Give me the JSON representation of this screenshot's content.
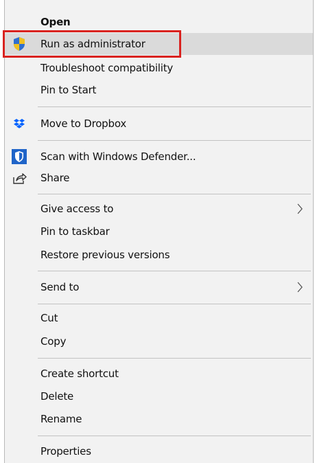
{
  "menu": {
    "items": [
      {
        "id": "open",
        "label": "Open",
        "icon": ""
      },
      {
        "id": "run_admin",
        "label": "Run as administrator",
        "icon": "shield-icon"
      },
      {
        "id": "troubleshoot",
        "label": "Troubleshoot compatibility",
        "icon": ""
      },
      {
        "id": "pin_start",
        "label": "Pin to Start",
        "icon": ""
      },
      {
        "id": "dropbox",
        "label": "Move to Dropbox",
        "icon": "dropbox-icon"
      },
      {
        "id": "defender",
        "label": "Scan with Windows Defender...",
        "icon": "windows-defender-icon"
      },
      {
        "id": "share",
        "label": "Share",
        "icon": "share-icon"
      },
      {
        "id": "give_access",
        "label": "Give access to",
        "icon": "",
        "submenu": true
      },
      {
        "id": "pin_taskbar",
        "label": "Pin to taskbar",
        "icon": ""
      },
      {
        "id": "restore",
        "label": "Restore previous versions",
        "icon": ""
      },
      {
        "id": "send_to",
        "label": "Send to",
        "icon": "",
        "submenu": true
      },
      {
        "id": "cut",
        "label": "Cut",
        "icon": ""
      },
      {
        "id": "copy",
        "label": "Copy",
        "icon": ""
      },
      {
        "id": "create_shortcut",
        "label": "Create shortcut",
        "icon": ""
      },
      {
        "id": "delete",
        "label": "Delete",
        "icon": ""
      },
      {
        "id": "rename",
        "label": "Rename",
        "icon": ""
      },
      {
        "id": "properties",
        "label": "Properties",
        "icon": ""
      }
    ],
    "hovered_item": "Run as administrator",
    "highlight_color": "#d9221f",
    "colors": {
      "shield_blue": "#2f6fd0",
      "shield_yellow": "#f0c020",
      "dropbox_blue": "#0061fe",
      "defender_blue": "#1f64c8"
    }
  }
}
